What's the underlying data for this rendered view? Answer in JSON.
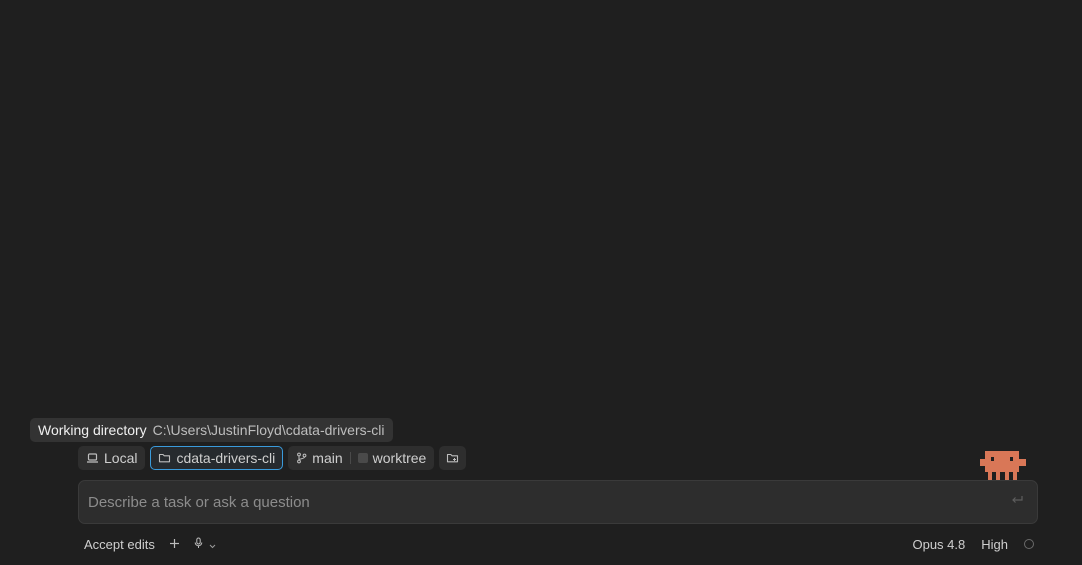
{
  "tooltip": {
    "title": "Working directory",
    "path": "C:\\Users\\JustinFloyd\\cdata-drivers-cli"
  },
  "chips": {
    "environment": "Local",
    "directory": "cdata-drivers-cli",
    "branch": "main",
    "worktree": "worktree"
  },
  "prompt": {
    "placeholder": "Describe a task or ask a question",
    "value": ""
  },
  "footer": {
    "mode": "Accept edits",
    "model": "Opus 4.8",
    "effort": "High"
  },
  "colors": {
    "background": "#1f1f1f",
    "accent_border": "#3a9bdc",
    "mascot": "#d97757"
  },
  "icons": [
    "laptop-icon",
    "folder-icon",
    "git-branch-icon",
    "worktree-checkbox",
    "folder-plus-icon",
    "enter-icon",
    "plus-icon",
    "mic-icon",
    "chevron-down-icon",
    "status-circle-icon",
    "mascot-icon"
  ]
}
